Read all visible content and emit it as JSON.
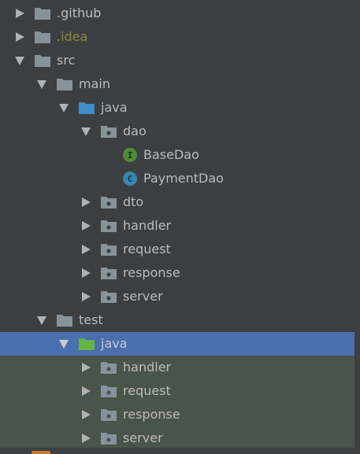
{
  "tree": {
    "github": {
      "label": ".github"
    },
    "idea": {
      "label": ".idea"
    },
    "src": {
      "label": "src"
    },
    "main": {
      "label": "main"
    },
    "main_java": {
      "label": "java"
    },
    "dao": {
      "label": "dao"
    },
    "basedao": {
      "label": "BaseDao",
      "icon_letter": "I"
    },
    "paymentdao": {
      "label": "PaymentDao",
      "icon_letter": "C"
    },
    "dto": {
      "label": "dto"
    },
    "main_handler": {
      "label": "handler"
    },
    "main_request": {
      "label": "request"
    },
    "main_response": {
      "label": "response"
    },
    "main_server": {
      "label": "server"
    },
    "test": {
      "label": "test"
    },
    "test_java": {
      "label": "java"
    },
    "test_handler": {
      "label": "handler"
    },
    "test_request": {
      "label": "request"
    },
    "test_response": {
      "label": "response"
    },
    "test_server": {
      "label": "server"
    }
  },
  "colors": {
    "background": "#3c3f41",
    "selection": "#4b6eaf",
    "test_zone": "#49544a",
    "folder": "#87939a",
    "source_folder": "#3d8ec9",
    "test_folder": "#62b543",
    "idea_text": "#8f8a3a"
  }
}
